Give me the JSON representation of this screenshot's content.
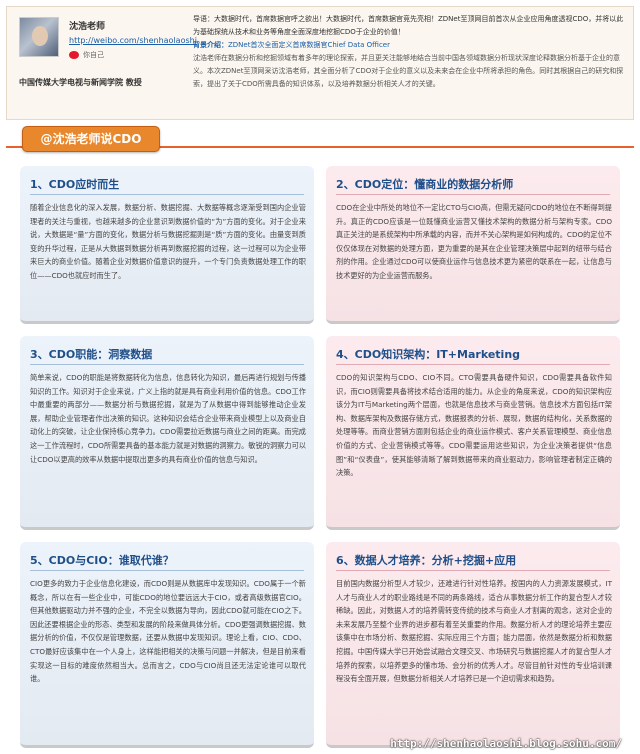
{
  "profile": {
    "name": "沈浩老师",
    "url": "http://weibo.com/shenhaolaoshi",
    "follow": "你自己",
    "title": "中国传媒大学电视与新闻学院 教授"
  },
  "intro": {
    "lead": "导语：大数据时代，首席数据官呼之欲出！大数据时代，首席数据官竞先亮相！ZDNet至顶网目前首次从企业应用角度透视CDO，并将以此为基础探统从技术和业务等角度全面深度地挖掘CDO于企业的价值！",
    "bg_label": "背景介绍：",
    "bg_link": "ZDNet首次全面定义首席数据官Chief Data Officer",
    "body": "沈浩老师在数据分析和挖掘领域有着多年的理论探索，并且更关注能够地结合当前中国各领域数据分析现状深度论释数据分析基于企业的意义。本次ZDNet至顶网采访沈浩老师，其全面分析了CDO对于企业的意义以及未来会在企业中所将承担的角色。同时其根据自己的研究和探索，提出了关于CDO所需具备的知识体系，以及培养数据分析相关人才的关键。"
  },
  "section_tag": "@沈浩老师说CDO",
  "cards": [
    {
      "title": "1、CDO应时而生",
      "body": "随着企业信息化的深入发展，数据分析、数据挖掘、大数据等概念逐渐受到国内企业管理者的关注与重视，也越来越多的企业意识到数据价值的“为”方面的变化。对于企业来说，大数据是“量”方面的变化，数据分析与数据挖掘则是“质”方面的变化。由量变到质变的升华过程，正是从大数据到数据分析再到数据挖掘的过程，这一过程可以为企业带来巨大的商业价值。随着企业对数据价值意识的提升，一个专门负责数据处理工作的职位——CDO也就应时而生了。"
    },
    {
      "title": "2、CDO定位：懂商业的数据分析师",
      "body": "CDO在企业中所处的地位不一定比CTO与CIO高，但需无疑问CDO的地位在不断得到提升。真正的CDO应该是一位既懂商业运营又懂技术架构的数据分析与架构专家。CDO真正关注的是系统架构中所承载的内容，而并不关心架构是如何构成的。CDO的定位不仅仅体现在对数据的处理方面，更为重要的是其在企业管理决策层中起到的纽带与结合剂的作用。企业通过CDO可以使商业运作与信息技术更为紧密的联系在一起，让信息与技术更好的为企业运营而服务。"
    },
    {
      "title": "3、CDO职能：洞察数据",
      "body": "简单来说，CDO的职能是将数据转化为信息，信息转化为知识，最后再进行规划与传播知识的工作。知识对于企业来说，广义上指的就是具有商业利用价值的信息。CDO工作中最重要的两部分——数据分析与数据挖掘，就是为了从数据中得到能够推动企业发展，帮助企业管理者作出决策的知识。这种知识会结合企业带来商业模型上以及商业自动化上的突破，让企业保持核心竞争力。CDO需要拉近数据与商业之间的距离。而完成这一工作流程时，CDO所需要具备的基本能力就是对数据的洞察力。敏锐的洞察力可以让CDO以更高的效率从数据中提取出更多的具有商业价值的信息与知识。"
    },
    {
      "title": "4、CDO知识架构：IT+Marketing",
      "body": "CDO的知识架构与CDO、CIO不同。CTO需要具备硬件知识，CDO需要具备软件知识，而CIO则需要具备将技术结合适用的能力。从企业的角度来说，CDO的知识架构应该分为IT与Marketing两个层面，也就是信息技术与商业营销。信息技术方面包括IT架构、数据库架构及数据存储方式，数据报表的分析、展现，数据的结构化，关系数据的处理等等。而商业营销方面则包括企业的商业运作模式、客户关系管理模型、商业信息价值的方式、企业营销模式等等。CDO需要运用这些知识，为企业决策者提供“信息图”和“仪表盘”，使其能够清晰了解到数据带来的商业驱动力，影响管理者制定正确的决策。"
    },
    {
      "title": "5、CDO与CIO：谁取代谁？",
      "body": "CIO更多的致力于企业信息化建设，而CDO则是从数据库中发现知识。CDO属于一个新概念，所以在有一些企业中，可能CDO的地位要远远大于CIO，或者高级数据官CIO。但其他数据驱动力并不强的企业，不完全以数据为导向，因此CDO就可能在CIO之下。因此还要根据企业的形态、类型和发展的阶段来做具体分析。CDO更强调数据挖掘、数据分析的价值，不仅仅是管理数据，还要从数据中发现知识。理论上看，CIO、CDO、CTO最好应该集中在一个人身上，这样能把相关的决策与问题一并解决，但是目前来看实现这一目标的难度依然相当大。总而言之，CDO与CIO尚且还无法定论谁可以取代谁。"
    },
    {
      "title": "6、数据人才培养：分析+挖掘+应用",
      "body": "目前国内数据分析型人才较少，还难进行针对性培养。按国内的人力资源发展模式，IT人才与商业人才的职业路线是不同的两条路线，适合从事数据分析工作的复合型人才较稀缺。因此，对数据人才的培养需转变传统的技术与商业人才割离的观念，这对企业的未来发展乃至整个业界的进步都有着至关重要的作用。数据分析人才的理论培养主要应该集中在市场分析、数据挖掘、实际应用三个方面；能力层面，依然是数据分析和数据挖掘。中国传媒大学已开始尝试融合文理交叉、市场研究与数据挖掘人才的复合型人才培养的探索，以培养更多的懂市场、会分析的优秀人才。尽管目前针对性的专业培训课程没有全面开展，但数据分析相关人才培养已是一个迫切需求和趋势。"
    }
  ],
  "watermark": "http://shenhaolaoshi.blog.sohu.com/",
  "colors": {
    "accent_orange": "#e8872b",
    "title_blue": "#1f4f8a",
    "link_blue": "#1a5ea8",
    "card_left_bg": "#edf3fa",
    "card_right_bg": "#fcebee"
  }
}
